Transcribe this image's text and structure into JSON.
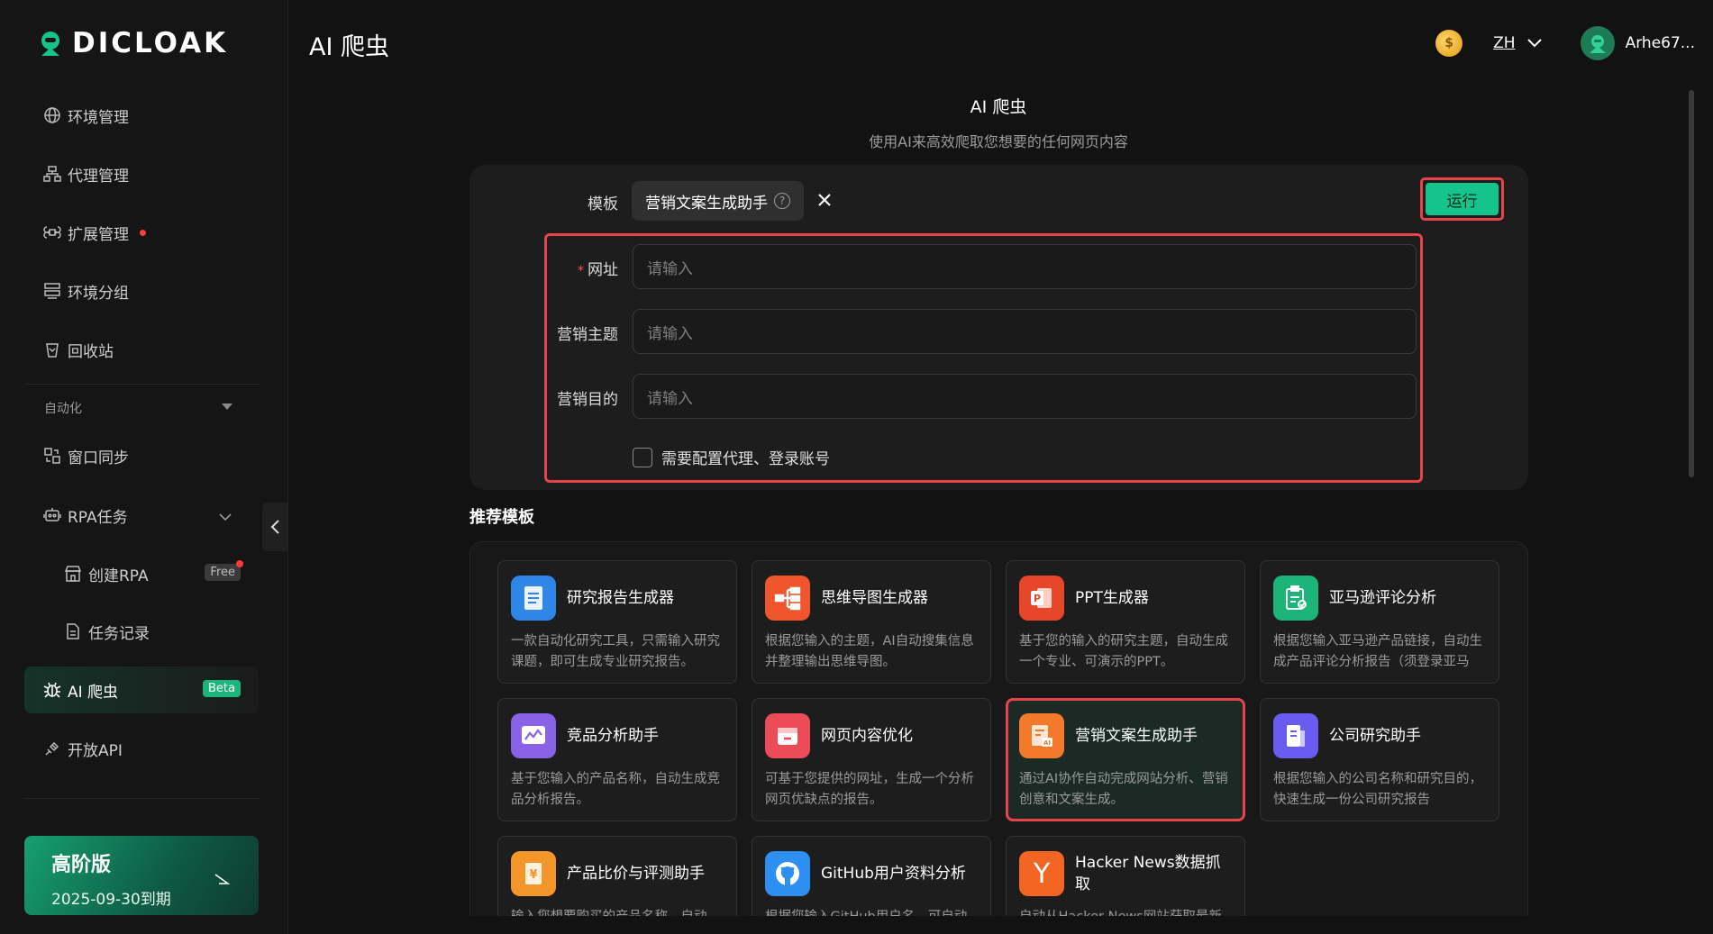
{
  "brand": {
    "name": "DICLOAK",
    "accent": "#14c48a"
  },
  "header": {
    "title": "AI 爬虫",
    "coin_icon": "coin-icon",
    "lang": "ZH",
    "username": "Arhe67..."
  },
  "sidebar": {
    "items": [
      {
        "label": "环境管理",
        "icon": "globe-icon"
      },
      {
        "label": "代理管理",
        "icon": "network-icon"
      },
      {
        "label": "扩展管理",
        "icon": "extension-icon"
      },
      {
        "label": "环境分组",
        "icon": "group-icon"
      },
      {
        "label": "回收站",
        "icon": "trash-icon"
      }
    ],
    "section_label": "自动化",
    "automation": [
      {
        "label": "窗口同步",
        "icon": "sync-icon"
      },
      {
        "label": "RPA任务",
        "icon": "robot-icon"
      }
    ],
    "rpa_sub": [
      {
        "label": "创建RPA",
        "badge": "Free",
        "icon": "store-icon"
      },
      {
        "label": "任务记录",
        "icon": "document-icon"
      }
    ],
    "ai_crawler": {
      "label": "AI 爬虫",
      "badge": "Beta"
    },
    "open_api": {
      "label": "开放API"
    },
    "premium": {
      "title": "高阶版",
      "expiry": "2025-09-30到期"
    }
  },
  "main": {
    "title": "AI 爬虫",
    "subtitle": "使用AI来高效爬取您想要的任何网页内容",
    "form": {
      "template_label": "模板",
      "template_value": "营销文案生成助手",
      "help": "?",
      "run_label": "运行",
      "fields": [
        {
          "label": "网址",
          "required": "*",
          "placeholder": "请输入"
        },
        {
          "label": "营销主题",
          "placeholder": "请输入"
        },
        {
          "label": "营销目的",
          "placeholder": "请输入"
        }
      ],
      "checkbox_label": "需要配置代理、登录账号"
    },
    "recommended_title": "推荐模板",
    "templates": [
      {
        "name": "研究报告生成器",
        "desc": "一款自动化研究工具，只需输入研究课题，即可生成专业研究报告。",
        "color": "#2f86e8",
        "icon": "report-icon"
      },
      {
        "name": "思维导图生成器",
        "desc": "根据您输入的主题，AI自动搜集信息并整理输出思维导图。",
        "color": "#f0552c",
        "icon": "mindmap-icon"
      },
      {
        "name": "PPT生成器",
        "desc": "基于您的输入的研究主题，自动生成一个专业、可演示的PPT。",
        "color": "#e8462a",
        "icon": "ppt-icon"
      },
      {
        "name": "亚马逊评论分析",
        "desc": "根据您输入亚马逊产品链接，自动生成产品评论分析报告（须登录亚马逊）",
        "color": "#1bb57a",
        "icon": "clipboard-icon"
      },
      {
        "name": "竞品分析助手",
        "desc": "基于您输入的产品名称，自动生成竞品分析报告。",
        "color": "#8a62e8",
        "icon": "chart-icon"
      },
      {
        "name": "网页内容优化",
        "desc": "可基于您提供的网址，生成一个分析网页优缺点的报告。",
        "color": "#ec4b58",
        "icon": "web-icon"
      },
      {
        "name": "营销文案生成助手",
        "desc": "通过AI协作自动完成网站分析、营销创意和文案生成。",
        "color": "#f27a2a",
        "icon": "ai-doc-icon"
      },
      {
        "name": "公司研究助手",
        "desc": "根据您输入的公司名称和研究目的，快速生成一份公司研究报告",
        "color": "#6a5cf0",
        "icon": "book-icon"
      },
      {
        "name": "产品比价与评测助手",
        "desc": "输入您想要购买的产品名称，自动",
        "color": "#f5962a",
        "icon": "price-icon"
      },
      {
        "name": "GitHub用户资料分析",
        "desc": "根据您输入GitHub用户名，可自动",
        "color": "#2d8ff0",
        "icon": "github-icon"
      },
      {
        "name": "Hacker News数据抓取",
        "desc": "自动从Hacker News网站获取最新",
        "color": "#f26522",
        "icon": "hackernews-icon",
        "glyph": "Y"
      }
    ]
  }
}
